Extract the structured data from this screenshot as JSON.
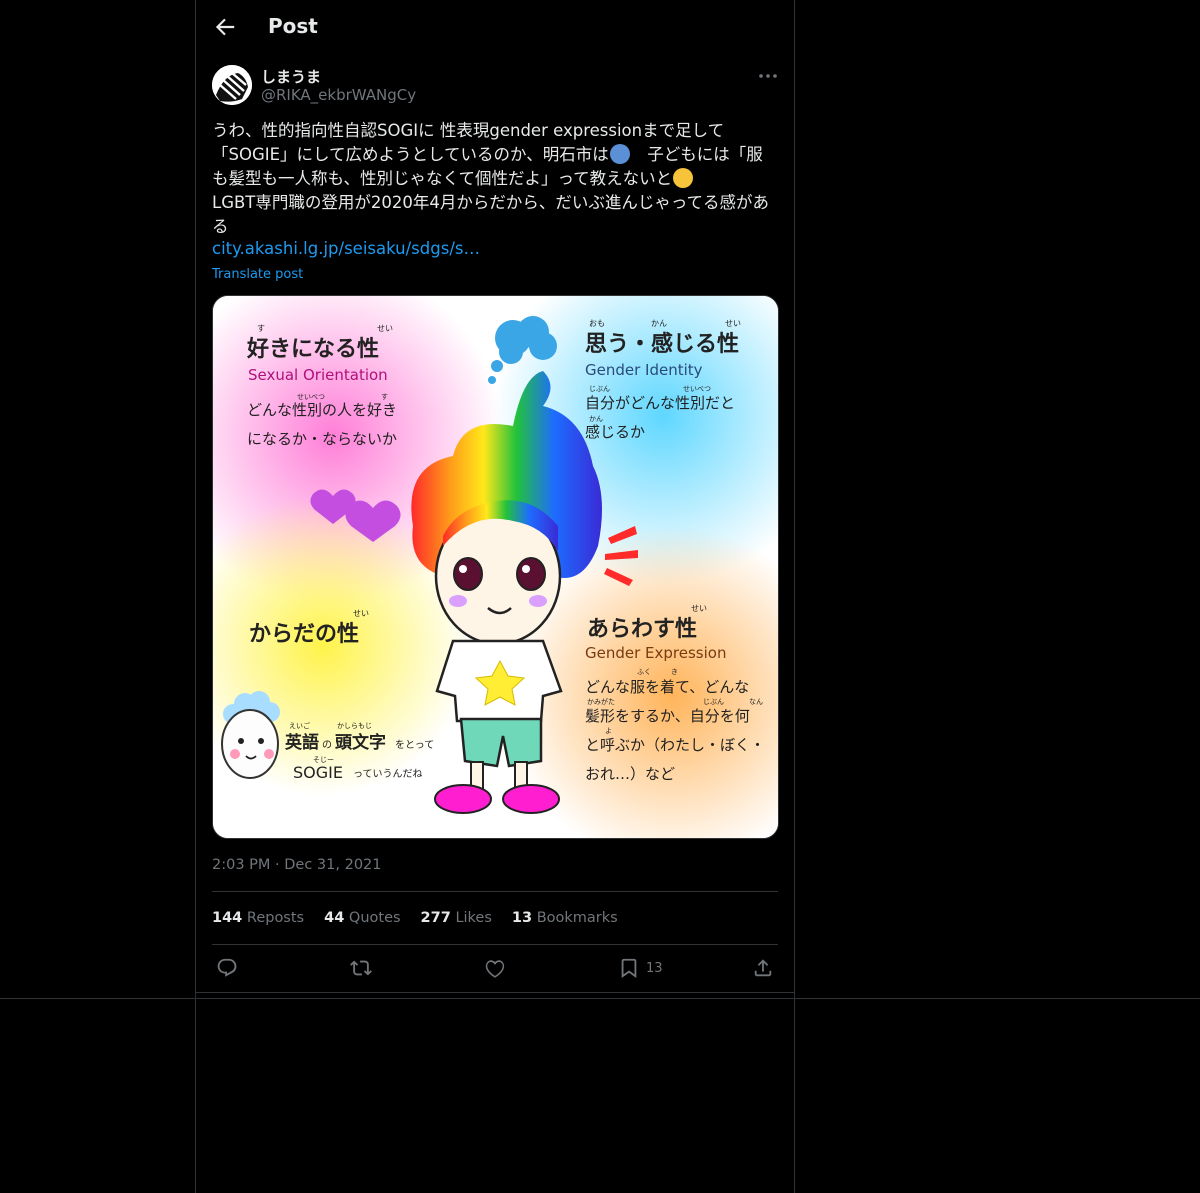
{
  "header": {
    "title": "Post"
  },
  "author": {
    "name": "しまうま",
    "handle": "@RIKA_ekbrWANgCy"
  },
  "tweet": {
    "line1": "うわ、性的指向性自認SOGIに 性表現gender expressionまで足して",
    "line2a": "「SOGIE」にして広めようとしているのか、明石市は",
    "line2b": "　子どもには「服",
    "line3a": "も髪型も一人称も、性別じゃなくて個性だよ」って教えないと",
    "line4": "LGBT専門職の登用が2020年4月からだから、だいぶ進んじゃってる感があ",
    "line5": "る",
    "link": "city.akashi.lg.jp/seisaku/sdgs/s…",
    "translate": "Translate post"
  },
  "media": {
    "q1_title": "好きになる性",
    "q1_ruby1": "す",
    "q1_ruby2": "せい",
    "q1_en": "Sexual Orientation",
    "q1_l1": "どんな性別の人を好き",
    "q1_l2": "になるか・ならないか",
    "q1_ruby3": "せいべつ",
    "q1_ruby4": "す",
    "q2_title": "思う・感じる性",
    "q2_ruby1": "おも",
    "q2_ruby2": "かん",
    "q2_ruby3": "せい",
    "q2_en": "Gender Identity",
    "q2_l1": "自分がどんな性別だと",
    "q2_l2": "感じるか",
    "q2_ruby4": "じぶん",
    "q2_ruby5": "せいべつ",
    "q2_ruby6": "かん",
    "q3_title": "からだの性",
    "q3_ruby": "せい",
    "q4_title": "あらわす性",
    "q4_ruby": "せい",
    "q4_en": "Gender Expression",
    "q4_l1": "どんな服を着て、どんな",
    "q4_l2": "髪形をするか、自分を何",
    "q4_l3": "と呼ぶか（わたし・ぼく・",
    "q4_l4": "おれ…）など",
    "q4_r1": "ふく",
    "q4_r2": "き",
    "q4_r3": "かみがた",
    "q4_r4": "じぶん",
    "q4_r5": "なん",
    "q4_r6": "よ",
    "egg_l1a": "英語",
    "egg_l1b": "の",
    "egg_l1c": "頭文字",
    "egg_l1d": "をとって",
    "egg_l2a": "SOGIE",
    "egg_l2b": "っていうんだね",
    "egg_r1": "えいご",
    "egg_r2": "かしらもじ",
    "egg_r3": "そじー"
  },
  "timestamp": "2:03 PM · Dec 31, 2021",
  "stats": {
    "reposts_num": "144",
    "reposts_label": "Reposts",
    "quotes_num": "44",
    "quotes_label": "Quotes",
    "likes_num": "277",
    "likes_label": "Likes",
    "bookmarks_num": "13",
    "bookmarks_label": "Bookmarks"
  },
  "actions": {
    "bookmark_count": "13"
  },
  "colors": {
    "accent": "#1d9bf0",
    "muted": "#71767b",
    "text": "#e7e9ea",
    "border": "#2f3336"
  },
  "icons": [
    "back-arrow-icon",
    "more-icon",
    "reply-icon",
    "repost-icon",
    "like-icon",
    "bookmark-icon",
    "share-icon"
  ]
}
